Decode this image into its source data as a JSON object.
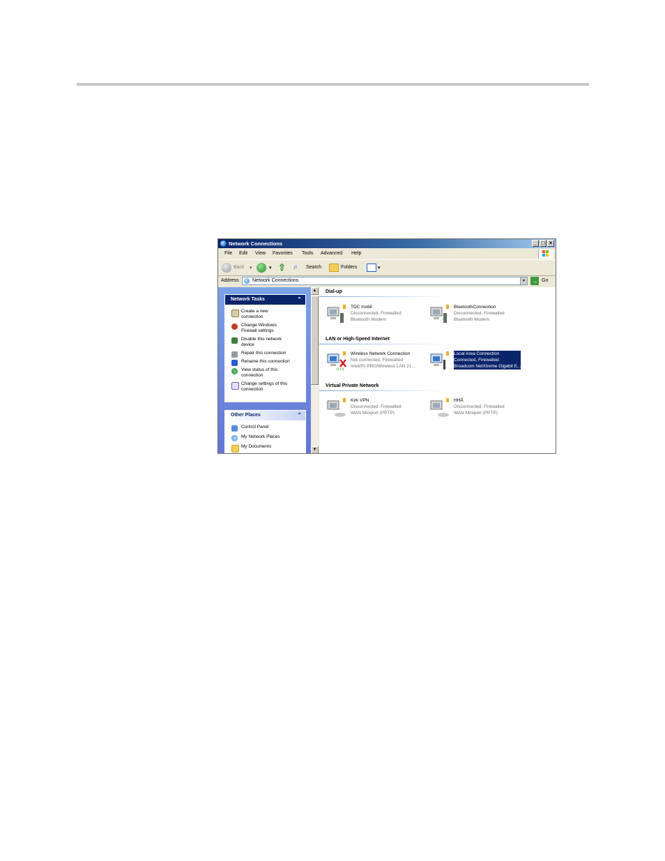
{
  "window": {
    "title": "Network Connections"
  },
  "menu": [
    "File",
    "Edit",
    "View",
    "Favorites",
    "Tools",
    "Advanced",
    "Help"
  ],
  "toolbar": {
    "back": "Back",
    "search": "Search",
    "folders": "Folders"
  },
  "address": {
    "label": "Address",
    "value": "Network Connections",
    "go": "Go"
  },
  "network_tasks": {
    "title": "Network Tasks",
    "items": [
      [
        "Create a new",
        "connection"
      ],
      [
        "Change Windows",
        "Firewall settings"
      ],
      [
        "Disable this network",
        "device"
      ],
      [
        "Repair this connection"
      ],
      [
        "Rename this connection"
      ],
      [
        "View status of this",
        "connection"
      ],
      [
        "Change settings of this",
        "connection"
      ]
    ]
  },
  "other_places": {
    "title": "Other Places",
    "items": [
      "Control Panel",
      "My Network Places",
      "My Documents"
    ]
  },
  "groups": [
    {
      "title": "Dial-up",
      "connections": [
        {
          "name": "TDC mobil",
          "status": "Disconnected, Firewalled",
          "device": "Bluetooth Modem"
        },
        {
          "name": "BluetoothConnection",
          "status": "Disconnected, Firewalled",
          "device": "Bluetooth Modem"
        }
      ]
    },
    {
      "title": "LAN or High-Speed Internet",
      "connections": [
        {
          "name": "Wireless Network Connection",
          "status": "Not connected, Firewalled",
          "device": "Intel(R) PRO/Wireless LAN 21..."
        },
        {
          "name": "Local Area Connection",
          "status": "Connected, Firewalled",
          "device": "Broadcom NetXtreme Gigabit E..."
        }
      ]
    },
    {
      "title": "Virtual Private Network",
      "connections": [
        {
          "name": "Kirk VPN",
          "status": "Disconnected, Firewalled",
          "device": "WAN Miniport (PPTP)"
        },
        {
          "name": "HHÅ",
          "status": "Disconnected, Firewalled",
          "device": "WAN Miniport (PPTP)"
        }
      ]
    }
  ],
  "colors": {
    "title_bar": "#0a246a",
    "task_pane": "#7ba2e7",
    "selection": "#0a246a"
  }
}
